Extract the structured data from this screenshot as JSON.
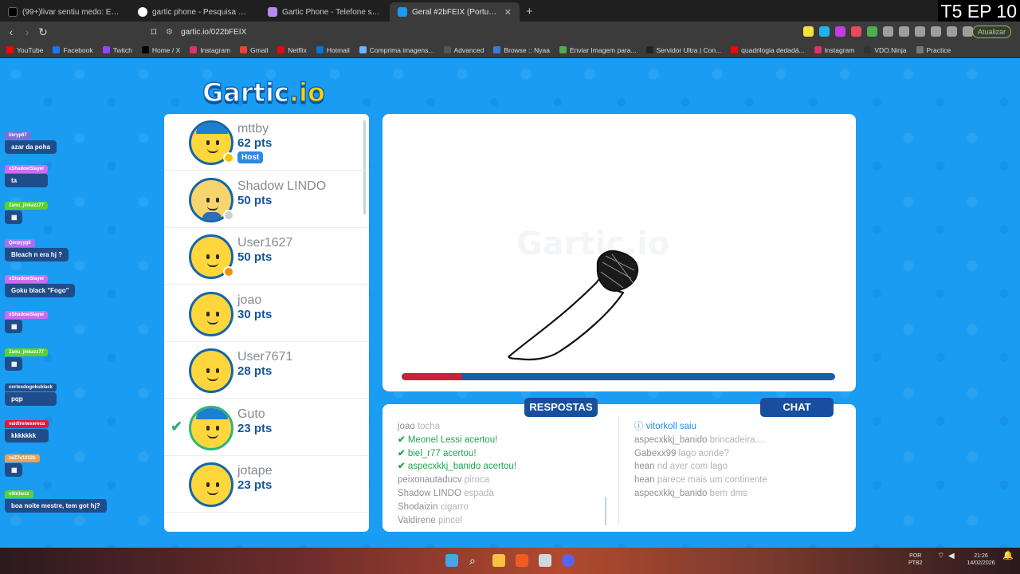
{
  "overlay_label": "T5 EP 10",
  "browser": {
    "tabs": [
      {
        "title": "(99+)livar sentiu medo: Emocionante",
        "color": "#000000",
        "active": false
      },
      {
        "title": "gartic phone - Pesquisa Google",
        "color": "#4285f4",
        "active": false
      },
      {
        "title": "Gartic Phone - Telefone sem fio",
        "color": "#7b3fd6",
        "active": false
      },
      {
        "title": "Geral #2bFEIX (Português) - Gartic",
        "color": "#1a9cf2",
        "active": true
      }
    ],
    "url": "gartic.io/022bFEIX",
    "update_label": "Atualizar",
    "bookmarks": [
      {
        "label": "YouTube",
        "color": "#ff0000"
      },
      {
        "label": "Facebook",
        "color": "#1877f2"
      },
      {
        "label": "Twitch",
        "color": "#9146ff"
      },
      {
        "label": "Home / X",
        "color": "#000000"
      },
      {
        "label": "Instagram",
        "color": "#e1306c"
      },
      {
        "label": "Gmail",
        "color": "#ea4335"
      },
      {
        "label": "Netflix",
        "color": "#e50914"
      },
      {
        "label": "Hotmail",
        "color": "#0078d4"
      },
      {
        "label": "Comprima imagens...",
        "color": "#6fb3ff"
      },
      {
        "label": "Advanced",
        "color": "#555555"
      },
      {
        "label": "Browse :: Nyaa",
        "color": "#3b7bd6"
      },
      {
        "label": "Enviar Imagem para...",
        "color": "#4caf50"
      },
      {
        "label": "Servidor Ultra | Con...",
        "color": "#222222"
      },
      {
        "label": "quadrilogia dedadá...",
        "color": "#ff0000"
      },
      {
        "label": "Instagram",
        "color": "#e1306c"
      },
      {
        "label": "VDO.Ninja",
        "color": "#333333"
      },
      {
        "label": "Practice",
        "color": "#777777"
      }
    ]
  },
  "game": {
    "logo_main": "Gartic",
    "logo_suffix": ".io",
    "host_badge": "Host",
    "players": [
      {
        "name": "mttby",
        "points": "62 pts",
        "host": true,
        "dot": "#f5c400",
        "avatar": "cap",
        "guessed": false
      },
      {
        "name": "Shadow LINDO",
        "points": "50 pts",
        "host": false,
        "dot": "#cfcfcf",
        "avatar": "blue",
        "guessed": false
      },
      {
        "name": "User1627",
        "points": "50 pts",
        "host": false,
        "dot": "#f29100",
        "avatar": "plain",
        "guessed": false
      },
      {
        "name": "joao",
        "points": "30 pts",
        "host": false,
        "dot": "",
        "avatar": "plain",
        "guessed": false
      },
      {
        "name": "User7671",
        "points": "28 pts",
        "host": false,
        "dot": "",
        "avatar": "plain",
        "guessed": false
      },
      {
        "name": "Guto",
        "points": "23 pts",
        "host": false,
        "dot": "",
        "avatar": "cap",
        "guessed": true
      },
      {
        "name": "jotape",
        "points": "23 pts",
        "host": false,
        "dot": "",
        "avatar": "plain",
        "guessed": false
      }
    ],
    "canvas_watermark": "Gartic.io",
    "timer_remaining_fraction": 0.14,
    "answers_label": "RESPOSTAS",
    "chat_label": "CHAT",
    "answers": [
      {
        "user": "joao",
        "text": "tocha",
        "correct": false
      },
      {
        "user": "Meonel Lessi",
        "text": "acertou!",
        "correct": true
      },
      {
        "user": "biel_r77",
        "text": "acertou!",
        "correct": true
      },
      {
        "user": "aspecxkkj_banido",
        "text": "acertou!",
        "correct": true
      },
      {
        "user": "peixonautaducv",
        "text": "piroca",
        "correct": false
      },
      {
        "user": "Shadow LINDO",
        "text": "espada",
        "correct": false
      },
      {
        "user": "Shodaizin",
        "text": "cigarro",
        "correct": false
      },
      {
        "user": "Valdirene",
        "text": "pincel",
        "correct": false
      }
    ],
    "chat": [
      {
        "user": "vitorkoll",
        "text": "saiu",
        "system": true
      },
      {
        "user": "aspecxkkj_banido",
        "text": "brincadeira....",
        "system": false
      },
      {
        "user": "Gabexx99",
        "text": "lago aonde?",
        "system": false
      },
      {
        "user": "hean",
        "text": "nd aver com lago",
        "system": false
      },
      {
        "user": "hean",
        "text": "parece mais um continente",
        "system": false
      },
      {
        "user": "aspecxkkj_banido",
        "text": "bem dms",
        "system": false
      }
    ]
  },
  "stream_chat": [
    {
      "user": "kkryp67",
      "text": "azar da poha",
      "color": "#7b6fd6"
    },
    {
      "user": "xShadowSlayer",
      "text": "ta",
      "color": "#c86ff0"
    },
    {
      "user": "Zanu_jinkazz77",
      "text": "",
      "color": "#5ad12f"
    },
    {
      "user": "Qerpyygli",
      "text": "Bleach n era hj ?",
      "color": "#a96ff0"
    },
    {
      "user": "xShadowSlayer",
      "text": "Goku black \"Fogo\"",
      "color": "#c86ff0"
    },
    {
      "user": "xShadowSlayer",
      "text": "",
      "color": "#c86ff0"
    },
    {
      "user": "Zanu_jinkazz77",
      "text": "",
      "color": "#5ad12f"
    },
    {
      "user": "cortesdogokublack",
      "text": "pqp",
      "color": "#1f4d8a"
    },
    {
      "user": "valdirenexereca",
      "text": "kkkkkkk",
      "color": "#e0183c"
    },
    {
      "user": "zeZ7e1012b",
      "text": "",
      "color": "#f0a050"
    },
    {
      "user": "vitinhozz",
      "text": "boa noite mestre, tem got hj?",
      "color": "#5ad12f"
    }
  ],
  "taskbar": {
    "lang": "POR",
    "lang2": "PTB2",
    "time": "21:26",
    "date": "14/02/2026"
  }
}
